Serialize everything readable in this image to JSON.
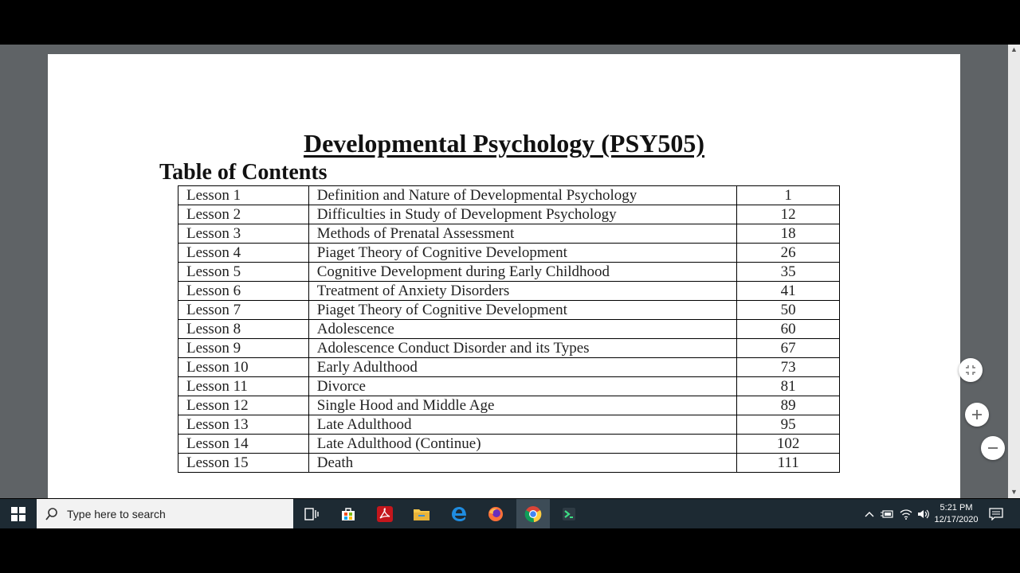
{
  "document": {
    "title": "Developmental Psychology (PSY505)",
    "toc_heading": "Table of Contents",
    "toc_rows": [
      {
        "lesson": "Lesson 1",
        "topic": "Definition and Nature of Developmental Psychology",
        "page": "1"
      },
      {
        "lesson": "Lesson 2",
        "topic": "Difficulties in Study of Development Psychology",
        "page": "12"
      },
      {
        "lesson": "Lesson 3",
        "topic": "Methods of Prenatal Assessment",
        "page": "18"
      },
      {
        "lesson": "Lesson 4",
        "topic": "Piaget Theory of Cognitive Development",
        "page": "26"
      },
      {
        "lesson": "Lesson 5",
        "topic": "Cognitive Development during Early Childhood",
        "page": "35"
      },
      {
        "lesson": "Lesson 6",
        "topic": "Treatment of Anxiety Disorders",
        "page": "41"
      },
      {
        "lesson": "Lesson 7",
        "topic": "Piaget Theory of Cognitive Development",
        "page": "50"
      },
      {
        "lesson": "Lesson 8",
        "topic": "Adolescence",
        "page": "60"
      },
      {
        "lesson": "Lesson 9",
        "topic": "Adolescence Conduct Disorder and its Types",
        "page": "67"
      },
      {
        "lesson": "Lesson 10",
        "topic": "Early Adulthood",
        "page": "73"
      },
      {
        "lesson": "Lesson 11",
        "topic": "Divorce",
        "page": "81"
      },
      {
        "lesson": "Lesson 12",
        "topic": "Single Hood and Middle Age",
        "page": "89"
      },
      {
        "lesson": "Lesson 13",
        "topic": "Late Adulthood",
        "page": "95"
      },
      {
        "lesson": "Lesson 14",
        "topic": "Late Adulthood (Continue)",
        "page": "102"
      },
      {
        "lesson": "Lesson 15",
        "topic": "Death",
        "page": "111"
      }
    ]
  },
  "viewer_controls": {
    "fit_icon": "fit-page-icon",
    "zoom_in_icon": "plus-icon",
    "zoom_out_icon": "minus-icon"
  },
  "taskbar": {
    "search_placeholder": "Type here to search",
    "apps": [
      "task-view-icon",
      "store-icon",
      "acrobat-icon",
      "file-explorer-icon",
      "edge-icon",
      "firefox-icon",
      "chrome-icon",
      "android-studio-icon"
    ],
    "active_app": "chrome-icon",
    "time": "5:21 PM",
    "date": "12/17/2020"
  }
}
